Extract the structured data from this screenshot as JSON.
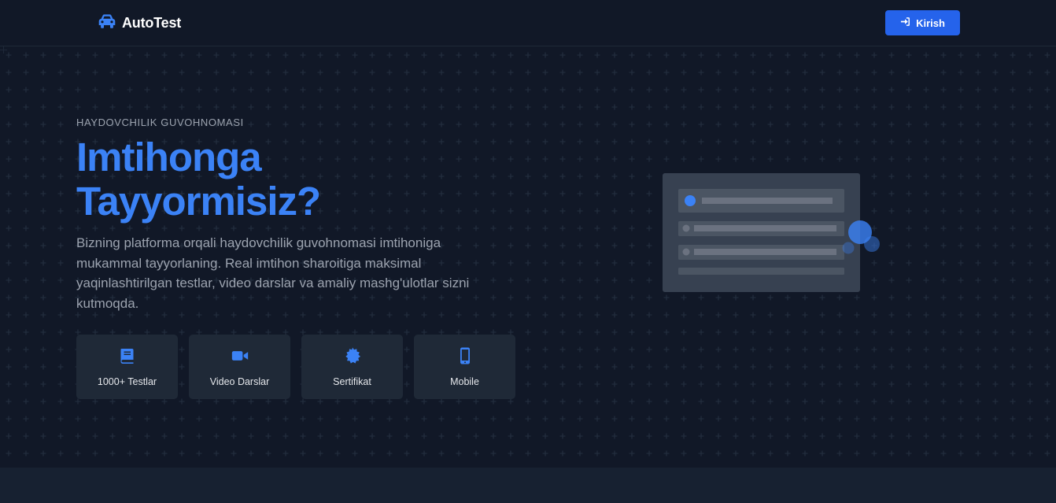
{
  "nav": {
    "brand": "AutoTest",
    "brand_icon": "car-icon",
    "login_label": "Kirish",
    "login_icon": "sign-in-icon"
  },
  "hero": {
    "eyebrow": "HAYDOVCHILIK GUVOHNOMASI",
    "title_line1": "Imtihonga",
    "title_line2": "Tayyormisiz?",
    "description": "Bizning platforma orqali haydovchilik guvohnomasi imtihoniga mukammal tayyorlaning. Real imtihon sharoitiga maksimal yaqinlashtirilgan testlar, video darslar va amaliy mashg'ulotlar sizni kutmoqda.",
    "features": [
      {
        "label": "1000+ Testlar",
        "icon": "book-icon"
      },
      {
        "label": "Video Darslar",
        "icon": "video-icon"
      },
      {
        "label": "Sertifikat",
        "icon": "certificate-icon"
      },
      {
        "label": "Mobile",
        "icon": "mobile-icon"
      }
    ]
  },
  "colors": {
    "background": "#111827",
    "accent": "#3b82f6",
    "button": "#2563eb",
    "card": "#1f2937",
    "muted_text": "#9ca3af"
  }
}
